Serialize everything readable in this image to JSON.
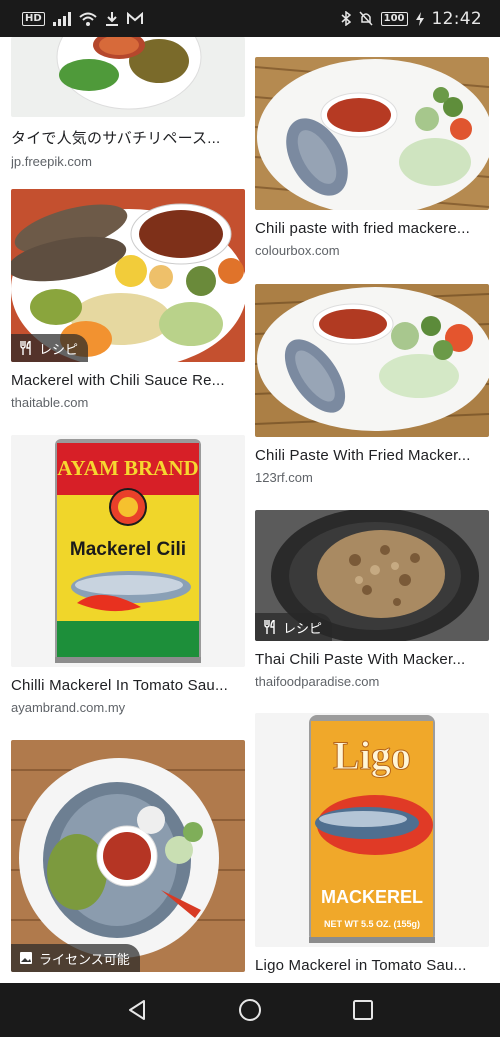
{
  "status_bar": {
    "hd": "HD",
    "battery": "100",
    "time": "12:42",
    "icons": [
      "signal-icon",
      "wifi-icon",
      "download-icon",
      "gmail-icon",
      "bluetooth-icon",
      "mute-icon",
      "charging-icon"
    ]
  },
  "results": [
    {
      "title": "タイで人気のサバチリペース...",
      "source": "jp.freepik.com",
      "badge": ""
    },
    {
      "title": "Chili paste with fried mackere...",
      "source": "colourbox.com",
      "badge": ""
    },
    {
      "title": "Mackerel with Chili Sauce Re...",
      "source": "thaitable.com",
      "badge": "レシピ",
      "badge_icon": "fork-knife-icon"
    },
    {
      "title": "Chili Paste With Fried Macker...",
      "source": "123rf.com",
      "badge": ""
    },
    {
      "title": "Chilli Mackerel In Tomato Sau...",
      "source": "ayambrand.com.my",
      "badge": "",
      "can_brand": "AYAM BRAND",
      "can_label": "Mackerel Cili"
    },
    {
      "title": "Thai Chili Paste With Macker...",
      "source": "thaifoodparadise.com",
      "badge": "レシピ",
      "badge_icon": "fork-knife-icon"
    },
    {
      "title": "",
      "source": "",
      "badge": "ライセンス可能",
      "badge_icon": "image-icon"
    },
    {
      "title": "Ligo Mackerel in Tomato Sau...",
      "source": "",
      "badge": "",
      "can_brand": "Ligo",
      "can_label": "MACKEREL",
      "can_net": "NET WT 5.5 OZ. (155g)"
    }
  ],
  "colors": {
    "bar": "#1a1a1a",
    "title": "#202124",
    "source": "#5f6368"
  },
  "nav": [
    "back-icon",
    "home-icon",
    "recents-icon"
  ]
}
